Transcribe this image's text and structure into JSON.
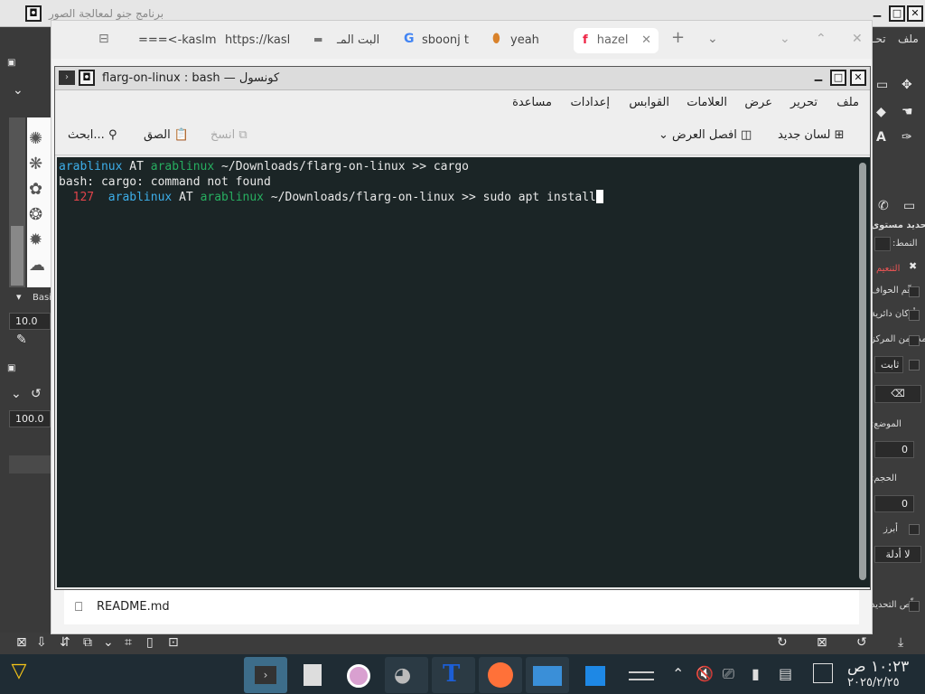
{
  "gimp": {
    "title": "برنامج جنو لمعالجة الصور",
    "brush_label": "Basi",
    "size_value": "10.0",
    "opacity_value": "100.0",
    "labels": {
      "update": "تحديد مستوى",
      "mode": "النمط:",
      "option1": "التنعيم",
      "option2": "نعِّم الحواف",
      "option3": "أركان دائرية",
      "option4": "مدد من المركز",
      "fixed": "ثابت",
      "position": "الموضع:",
      "position_value": "0",
      "size": "الحجم:",
      "size_value2": "0",
      "highlight": "أبرز",
      "guides": "لا أدلة",
      "shrink": "قلّص التحديد"
    }
  },
  "browser": {
    "tabs": [
      {
        "label": "===<-kaslm"
      },
      {
        "label": "https://kasl"
      },
      {
        "label": "البت المـ"
      },
      {
        "label": "sboonj t"
      },
      {
        "label": "yeah"
      },
      {
        "label": "hazel"
      }
    ],
    "menu_label": "ملف",
    "menu_label2": "تحـ",
    "footer_file": "README.md"
  },
  "konsole": {
    "title": "flarg-on-linux : bash — كونسول",
    "menu": [
      "ملف",
      "تحرير",
      "عرض",
      "العلامات",
      "القوابس",
      "إعدادات",
      "مساعدة"
    ],
    "toolbar": {
      "new_tab": "لسان جديد",
      "split_view": "افصل العرض",
      "copy": "انسخ",
      "paste": "الصق",
      "find": "ابحث..."
    },
    "lines": {
      "l1_user": "arablinux",
      "l1_at": " AT ",
      "l1_host": "arablinux",
      "l1_rest": " ~/Downloads/flarg-on-linux >> cargo",
      "l2": "bash: cargo: command not found",
      "l3_code": "  127  ",
      "l3_user": "arablinux",
      "l3_at": " AT ",
      "l3_host": "arablinux",
      "l3_rest": " ~/Downloads/flarg-on-linux >> sudo apt install"
    }
  },
  "taskbar": {
    "clock_time": "١٠:٢٣ ص",
    "clock_date": "٢٠٢٥/٢/٢٥"
  }
}
